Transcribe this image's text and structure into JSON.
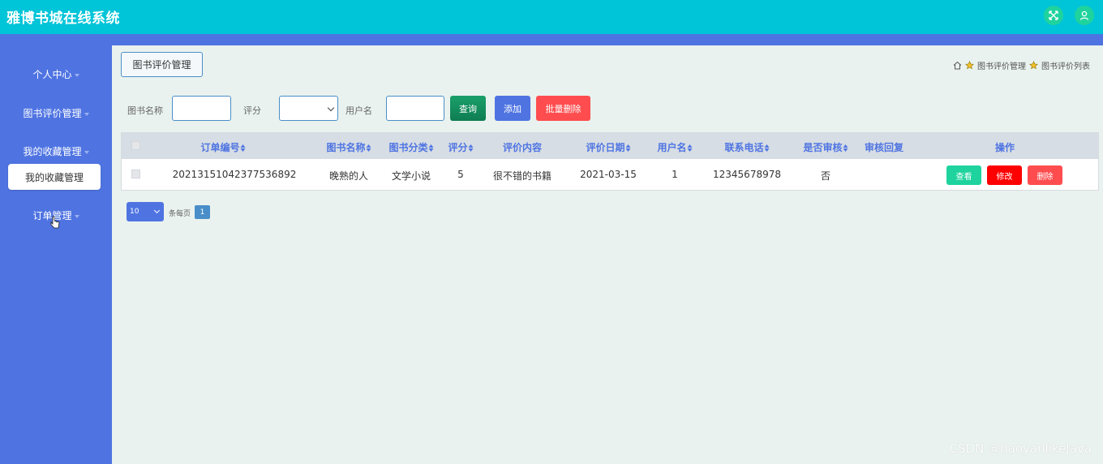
{
  "app": {
    "title": "雅博书城在线系统"
  },
  "colors": {
    "topbar": "#00c4d8",
    "sidebar": "#4f74e2",
    "accent_green": "#1fd39e",
    "danger": "#ff0000",
    "batch_delete": "#ff4d4f"
  },
  "header": {
    "icons": [
      "fullscreen-icon",
      "user-icon"
    ]
  },
  "sidebar": {
    "items": [
      {
        "label": "个人中心"
      },
      {
        "label": "图书评价管理"
      },
      {
        "label": "我的收藏管理"
      },
      {
        "label": "订单管理"
      }
    ],
    "active_sub": "我的收藏管理"
  },
  "page": {
    "tab_title": "图书评价管理",
    "breadcrumb": [
      "图书评价管理",
      "图书评价列表"
    ]
  },
  "search": {
    "book_name_label": "图书名称",
    "rating_label": "评分",
    "username_label": "用户名",
    "book_name_value": "",
    "rating_value": "",
    "username_value": "",
    "query_button": "查询",
    "add_button": "添加",
    "batch_delete_button": "批量删除"
  },
  "table": {
    "columns": [
      "订单编号",
      "图书名称",
      "图书分类",
      "评分",
      "评价内容",
      "评价日期",
      "用户名",
      "联系电话",
      "是否审核",
      "审核回复",
      "操作"
    ],
    "rows": [
      {
        "order_no": "20213151042377536892",
        "book_name": "晚熟的人",
        "category": "文学小说",
        "rating": "5",
        "content": "很不错的书籍",
        "date": "2021-03-15",
        "username": "1",
        "phone": "12345678978",
        "audited": "否",
        "reply": "",
        "actions": {
          "view": "查看",
          "edit": "修改",
          "delete": "删除"
        }
      }
    ]
  },
  "pagination": {
    "page_size": "10",
    "page_size_label": "条每页",
    "current_page": "1"
  },
  "watermark": "CSDN @haoyanlikeJava"
}
